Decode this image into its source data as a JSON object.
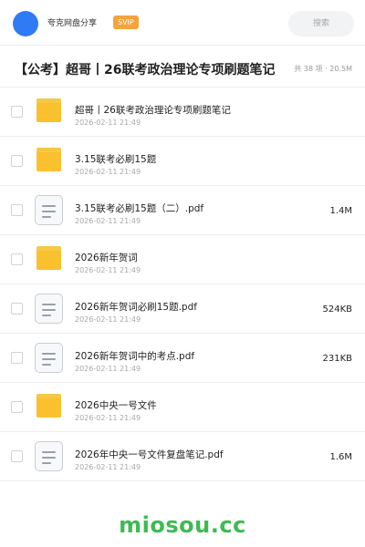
{
  "header": {
    "share_name": "夸克网盘分享",
    "badge": "SVIP",
    "search_label": "搜索"
  },
  "folder": {
    "title": "【公考】超哥丨26联考政治理论专项刷题笔记",
    "meta": "共 38 项 · 20.5M"
  },
  "files": [
    {
      "type": "folder",
      "icon": "folder-icon",
      "name": "超哥丨26联考政治理论专项刷题笔记",
      "time": "2026-02-11 21:49",
      "size": ""
    },
    {
      "type": "folder",
      "icon": "folder-icon",
      "name": "3.15联考必刷15题",
      "time": "2026-02-11 21:49",
      "size": ""
    },
    {
      "type": "pdf",
      "icon": "document-icon",
      "name": "3.15联考必刷15题（二）.pdf",
      "time": "2026-02-11 21:49",
      "size": "1.4M"
    },
    {
      "type": "folder",
      "icon": "folder-icon",
      "name": "2026新年贺词",
      "time": "2026-02-11 21:49",
      "size": ""
    },
    {
      "type": "pdf",
      "icon": "document-icon",
      "name": "2026新年贺词必刷15题.pdf",
      "time": "2026-02-11 21:49",
      "size": "524KB"
    },
    {
      "type": "pdf",
      "icon": "document-icon",
      "name": "2026新年贺词中的考点.pdf",
      "time": "2026-02-11 21:49",
      "size": "231KB"
    },
    {
      "type": "folder",
      "icon": "folder-icon",
      "name": "2026中央一号文件",
      "time": "2026-02-11 21:49",
      "size": ""
    },
    {
      "type": "pdf",
      "icon": "document-icon",
      "name": "2026年中央一号文件复盘笔记.pdf",
      "time": "2026-02-11 21:49",
      "size": "1.6M"
    }
  ],
  "watermark": "miosou.cc",
  "colors": {
    "accent": "#2f7bf6",
    "badge": "#f6a33a",
    "folder": "#fbc02d",
    "watermark": "#3dbb52"
  }
}
